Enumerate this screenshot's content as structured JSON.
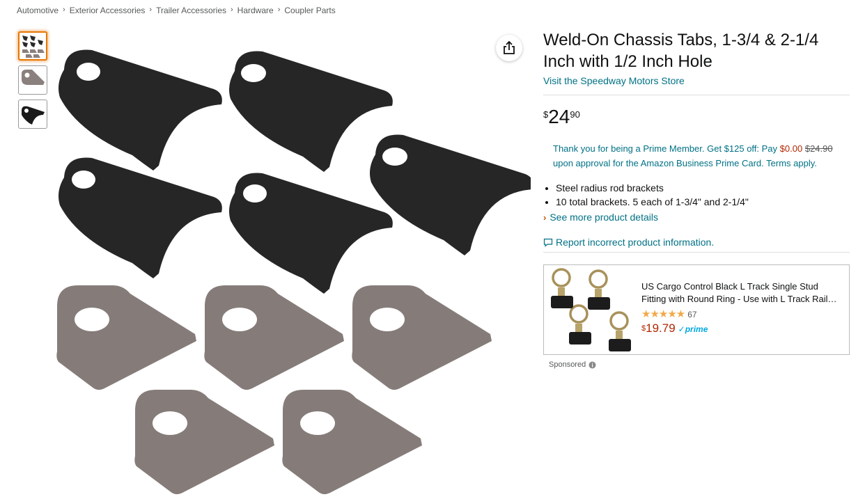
{
  "breadcrumb": [
    "Automotive",
    "Exterior Accessories",
    "Trailer Accessories",
    "Hardware",
    "Coupler Parts"
  ],
  "product": {
    "title": "Weld-On Chassis Tabs, 1-3/4 & 2-1/4 Inch with 1/2 Inch Hole",
    "store_link": "Visit the Speedway Motors Store",
    "price_symbol": "$",
    "price_whole": "24",
    "price_fraction": "90",
    "prime_offer": {
      "text1": "Thank you for being a Prime Member. Get $125 off: Pay",
      "pay_price": "$0.00",
      "old_price": "$24.90",
      "text2": "upon approval for the Amazon Business Prime Card. Terms apply."
    },
    "bullets": [
      "Steel radius rod brackets",
      "10 total brackets. 5 each of 1-3/4\" and 2-1/4\""
    ],
    "see_more": "See more product details",
    "report": "Report incorrect product information."
  },
  "ad": {
    "title": "US Cargo Control Black L Track Single Stud Fitting with Round Ring - Use with L Track Rail…",
    "stars": "★★★★★",
    "rating_count": "67",
    "price_symbol": "$",
    "price": "19.79",
    "prime_label": "✓prime",
    "sponsored": "Sponsored"
  },
  "colors": {
    "link": "#007185",
    "price_red": "#b12704",
    "star": "#f3a847",
    "thumb_active": "#e77600"
  }
}
